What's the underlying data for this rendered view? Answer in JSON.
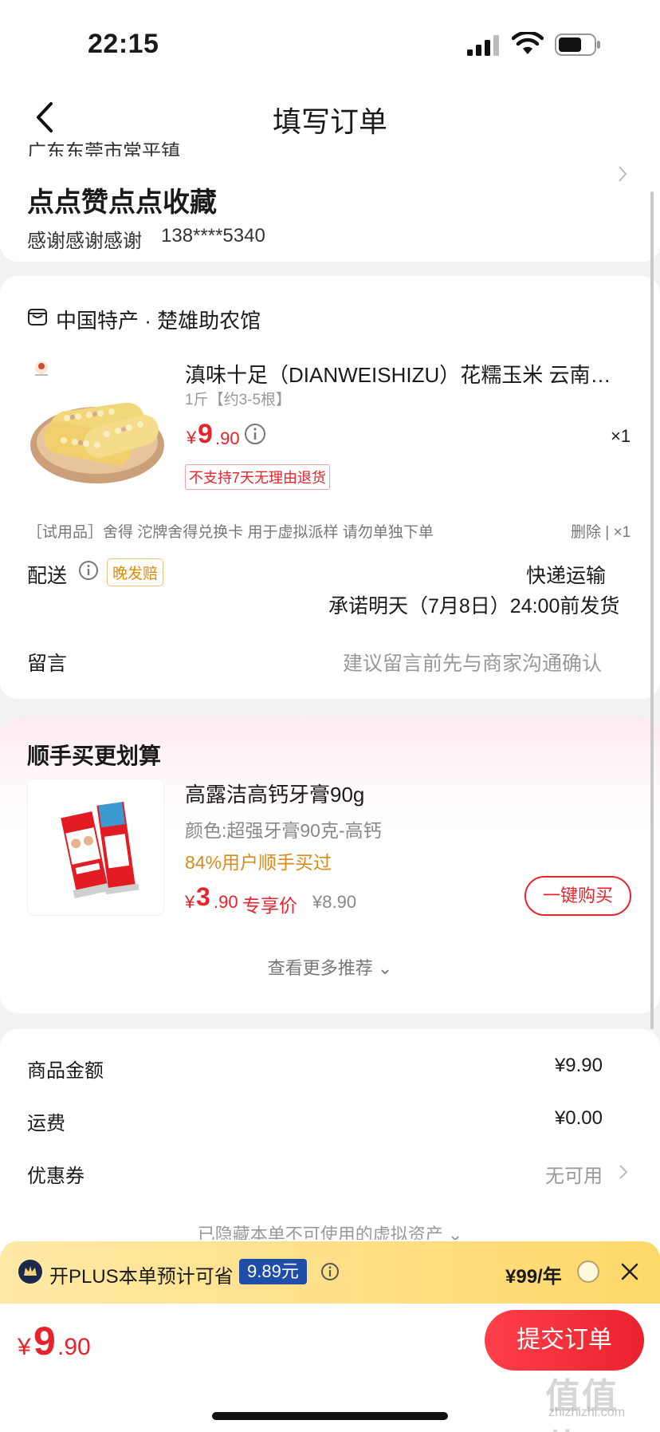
{
  "status_bar": {
    "time": "22:15"
  },
  "header": {
    "title": "填写订单"
  },
  "address": {
    "region": "广东东莞市常平镇",
    "name": "点点赞点点收藏",
    "contact_name": "感谢感谢感谢",
    "phone": "138****5340"
  },
  "order": {
    "shop_name": "中国特产 · 楚雄助农馆",
    "product": {
      "title": "滇味十足（DIANWEISHIZU）花糯玉米 云南西双…",
      "spec": "1斤【约3-5根】",
      "price_symbol": "¥",
      "price_int": "9",
      "price_dec": ".90",
      "qty": "×1",
      "no_return": "不支持7天无理由退货"
    },
    "trial": {
      "text": "［试用品］舍得 沱牌舍得兑换卡 用于虚拟派样 请勿单独下单",
      "actions": "删除 | ×1"
    },
    "delivery": {
      "label": "配送",
      "late_badge": "晚发赔",
      "method": "快递运输",
      "promise": "承诺明天（7月8日）24:00前发货"
    },
    "message": {
      "label": "留言",
      "placeholder": "建议留言前先与商家沟通确认"
    }
  },
  "upsell": {
    "title": "顺手买更划算",
    "product_name": "高露洁高钙牙膏90g",
    "spec": "颜色:超强牙膏90克-高钙",
    "bought": "84%用户顺手买过",
    "price_symbol": "¥",
    "price_int": "3",
    "price_dec": ".90",
    "exclusive_label": "专享价",
    "original_price": "¥8.90",
    "buy_label": "一键购买",
    "more_label": "查看更多推荐 ⌄"
  },
  "summary": {
    "goods_label": "商品金额",
    "goods_value": "¥9.90",
    "shipping_label": "运费",
    "shipping_value": "¥0.00",
    "coupon_label": "优惠券",
    "coupon_value": "无可用",
    "hidden_assets": "已隐藏本单不可使用的虚拟资产 ⌄"
  },
  "plus": {
    "text": "开PLUS本单预计可省",
    "savings": "9.89元",
    "price": "¥99/年"
  },
  "footer": {
    "total_symbol": "¥",
    "total_int": "9",
    "total_dec": ".90",
    "submit_label": "提交订单",
    "watermark": "值值值",
    "watermark_sub": "zhizhizhi.com"
  },
  "colors": {
    "accent_red": "#e8232c",
    "plus_blue": "#1f4da8",
    "plus_gold": "#ffd86a",
    "bought_orange": "#d98a1c"
  }
}
